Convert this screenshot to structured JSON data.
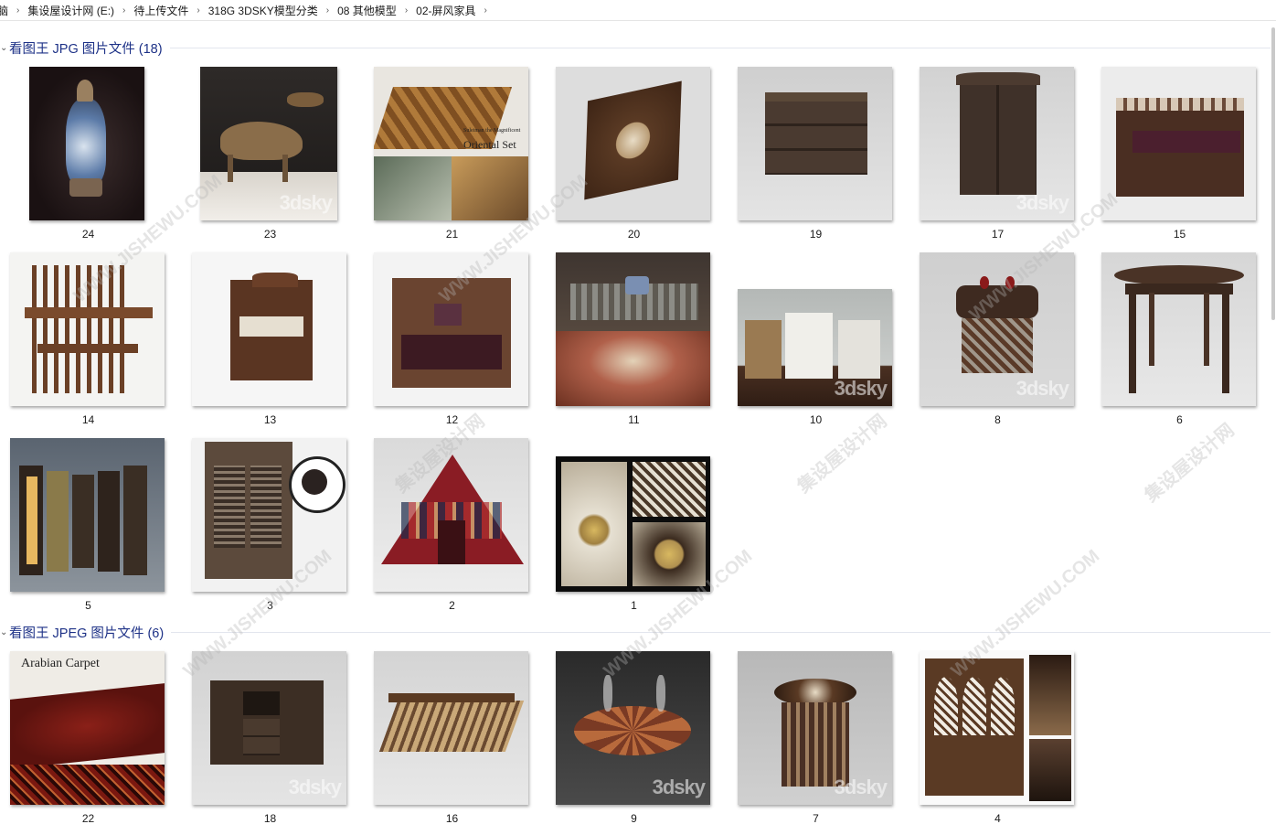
{
  "breadcrumb": [
    "脑",
    "集设屋设计网 (E:)",
    "待上传文件",
    "318G 3DSKY模型分类",
    "08 其他模型",
    "02-屏风家具"
  ],
  "groups": [
    {
      "title": "看图王 JPG 图片文件 (18)",
      "items": [
        "24",
        "23",
        "21",
        "20",
        "19",
        "17",
        "15",
        "14",
        "13",
        "12",
        "11",
        "10",
        "8",
        "6",
        "5",
        "3",
        "2",
        "1"
      ]
    },
    {
      "title": "看图王 JPEG 图片文件 (6)",
      "items": [
        "22",
        "18",
        "16",
        "9",
        "7",
        "4"
      ]
    }
  ],
  "thumb_texts": {
    "oriental_set_sub": "Suleiman the Magnificent",
    "oriental_set_title": "Oriental Set",
    "arabian_carpet": "Arabian Carpet",
    "watermark": "3dsky",
    "site_watermark": "WWW.JISHEWU.COM",
    "site_watermark_cn": "集设屋设计网"
  },
  "colors": {
    "group_title": "#1e3287",
    "separator": "#e3e6ee"
  }
}
